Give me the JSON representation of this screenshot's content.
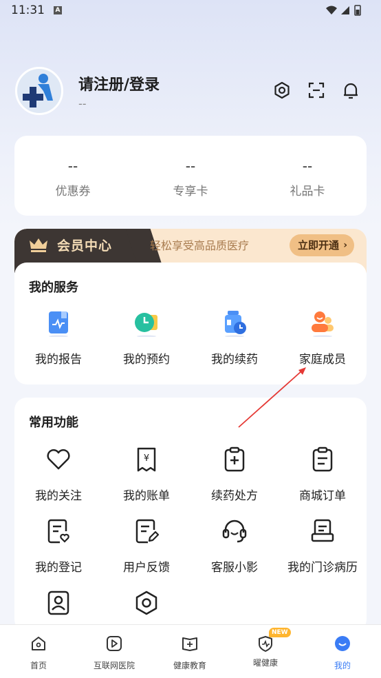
{
  "status_bar": {
    "time": "11:31",
    "notif_badge": "A"
  },
  "profile": {
    "name": "请注册/登录",
    "sub": "--"
  },
  "stats": [
    {
      "value": "--",
      "label": "优惠券"
    },
    {
      "value": "--",
      "label": "专享卡"
    },
    {
      "value": "--",
      "label": "礼品卡"
    }
  ],
  "vip": {
    "title": "会员中心",
    "desc": "轻松享受高品质医疗",
    "button": "立即开通"
  },
  "services": {
    "title": "我的服务",
    "items": [
      {
        "label": "我的报告",
        "icon": "report-icon"
      },
      {
        "label": "我的预约",
        "icon": "appointment-icon"
      },
      {
        "label": "我的续药",
        "icon": "medicine-refill-icon"
      },
      {
        "label": "家庭成员",
        "icon": "family-members-icon"
      }
    ]
  },
  "common": {
    "title": "常用功能",
    "items": [
      {
        "label": "我的关注",
        "icon": "heart-icon"
      },
      {
        "label": "我的账单",
        "icon": "bill-icon"
      },
      {
        "label": "续药处方",
        "icon": "prescription-icon"
      },
      {
        "label": "商城订单",
        "icon": "order-icon"
      },
      {
        "label": "我的登记",
        "icon": "registration-icon"
      },
      {
        "label": "用户反馈",
        "icon": "feedback-icon"
      },
      {
        "label": "客服小影",
        "icon": "customer-service-icon"
      },
      {
        "label": "我的门诊病历",
        "icon": "medical-record-icon"
      }
    ]
  },
  "nav": {
    "items": [
      {
        "label": "首页",
        "icon": "home-icon"
      },
      {
        "label": "互联网医院",
        "icon": "play-icon"
      },
      {
        "label": "健康教育",
        "icon": "book-icon"
      },
      {
        "label": "曜健康",
        "icon": "shield-icon"
      },
      {
        "label": "我的",
        "icon": "profile-icon"
      }
    ],
    "badge": "NEW",
    "active_color": "#3a7cf5"
  },
  "colors": {
    "accent": "#3a7cf5",
    "vip_dark": "#3d3633",
    "vip_gold": "#f0bf85",
    "annotation": "#e53935"
  }
}
